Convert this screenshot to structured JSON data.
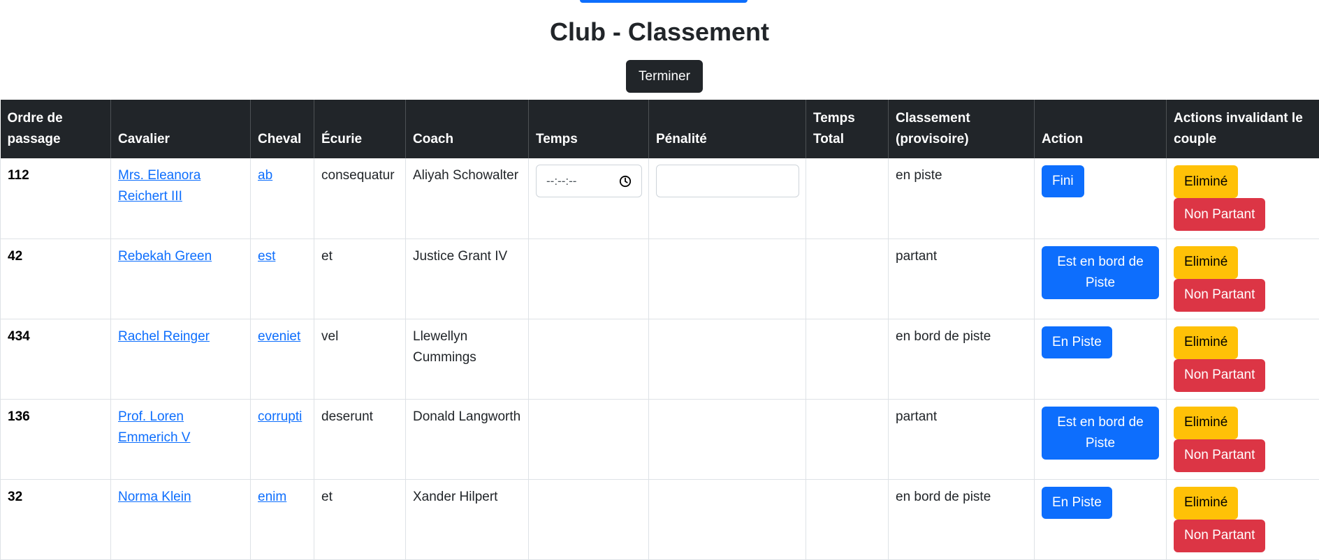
{
  "page": {
    "title": "Club - Classement",
    "finish_label": "Terminer"
  },
  "table": {
    "headers": [
      "Ordre de passage",
      "Cavalier",
      "Cheval",
      "Écurie",
      "Coach",
      "Temps",
      "Pénalité",
      "Temps Total",
      "Classement (provisoire)",
      "Action",
      "Actions invalidant le couple"
    ],
    "time_placeholder": "--:--:--",
    "eliminated_label": "Eliminé",
    "non_starter_label": "Non Partant",
    "rows": [
      {
        "ordre": "112",
        "cavalier": "Mrs. Eleanora Reichert III",
        "cheval": "ab",
        "ecurie": "consequatur",
        "coach": "Aliyah Schowalter",
        "classement": "en piste",
        "action": "Fini"
      },
      {
        "ordre": "42",
        "cavalier": "Rebekah Green",
        "cheval": "est",
        "ecurie": "et",
        "coach": "Justice Grant IV",
        "classement": "partant",
        "action": "Est en bord de Piste"
      },
      {
        "ordre": "434",
        "cavalier": "Rachel Reinger",
        "cheval": "eveniet",
        "ecurie": "vel",
        "coach": "Llewellyn Cummings",
        "classement": "en bord de piste",
        "action": "En Piste"
      },
      {
        "ordre": "136",
        "cavalier": "Prof. Loren Emmerich V",
        "cheval": "corrupti",
        "ecurie": "deserunt",
        "coach": "Donald Langworth",
        "classement": "partant",
        "action": "Est en bord de Piste"
      },
      {
        "ordre": "32",
        "cavalier": "Norma Klein",
        "cheval": "enim",
        "ecurie": "et",
        "coach": "Xander Hilpert",
        "classement": "en bord de piste",
        "action": "En Piste"
      }
    ]
  }
}
